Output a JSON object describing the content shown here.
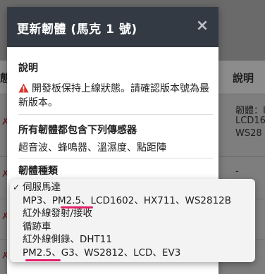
{
  "modal": {
    "title": "更新韌體 (馬克 1 號)",
    "close_glyph": "×",
    "description_heading": "說明",
    "description_text": "開發板保持上線狀態。請確認版本號為最新版本。",
    "sensors_heading": "所有韌體都包含下列傳感器",
    "sensors_text": "超音波、蜂鳴器、溫濕度、點距陣",
    "firmware_type_heading": "韌體種類"
  },
  "firmware_options": [
    {
      "label": "伺服馬達",
      "selected": true
    },
    {
      "label": "MP3、PM2.5、LCD1602、HX711、WS2812B",
      "selected": false
    },
    {
      "label": "紅外線發射/接收",
      "selected": false
    },
    {
      "label": "循跡車",
      "selected": false
    },
    {
      "label": "紅外線側錄、DHT11",
      "selected": false
    },
    {
      "label": "PM2.5、G3、WS2812、LCD、EV3",
      "selected": false
    }
  ],
  "background": {
    "header_left": "態",
    "header_right": "說明",
    "row1": [
      "韌體：I",
      "LCD16",
      "WS28"
    ],
    "row2": "-"
  },
  "colors": {
    "modal_header": "#333a43",
    "warning": "#d9342b",
    "highlight_underline": "#e0216b",
    "select_border": "#6a8dbf"
  },
  "icons": {
    "warning": "warning-triangle-icon",
    "close": "close-icon",
    "check": "checkmark-icon"
  }
}
